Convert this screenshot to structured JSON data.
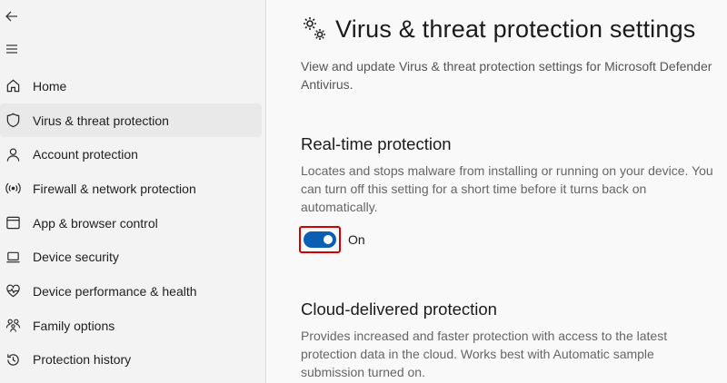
{
  "sidebar": {
    "back_icon": "back-arrow-icon",
    "menu_icon": "hamburger-menu-icon",
    "items": [
      {
        "label": "Home",
        "icon": "home-icon",
        "active": false
      },
      {
        "label": "Virus & threat protection",
        "icon": "shield-icon",
        "active": true
      },
      {
        "label": "Account protection",
        "icon": "person-icon",
        "active": false
      },
      {
        "label": "Firewall & network protection",
        "icon": "wifi-icon",
        "active": false
      },
      {
        "label": "App & browser control",
        "icon": "browser-window-icon",
        "active": false
      },
      {
        "label": "Device security",
        "icon": "laptop-icon",
        "active": false
      },
      {
        "label": "Device performance & health",
        "icon": "heart-pulse-icon",
        "active": false
      },
      {
        "label": "Family options",
        "icon": "family-icon",
        "active": false
      },
      {
        "label": "Protection history",
        "icon": "history-icon",
        "active": false
      }
    ]
  },
  "main": {
    "title_icon": "gears-icon",
    "title": "Virus & threat protection settings",
    "description": "View and update Virus & threat protection settings for Microsoft Defender Antivirus.",
    "realtime": {
      "heading": "Real-time protection",
      "description": "Locates and stops malware from installing or running on your device. You can turn off this setting for a short time before it turns back on automatically.",
      "toggle_label": "On",
      "toggle_on": true
    },
    "cloud": {
      "heading": "Cloud-delivered protection",
      "description": "Provides increased and faster protection with access to the latest protection data in the cloud. Works best with Automatic sample submission turned on."
    }
  },
  "colors": {
    "accent": "#0a5fb4",
    "highlight_outline": "#d40000",
    "sidebar_bg": "#f3f3f3",
    "main_bg": "#f9f9f9"
  }
}
